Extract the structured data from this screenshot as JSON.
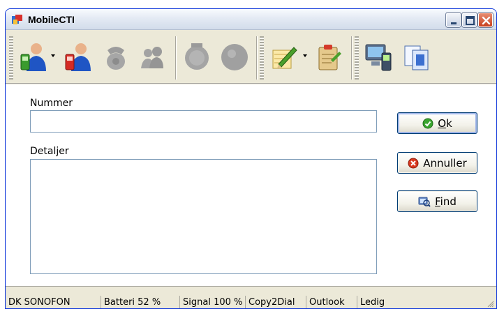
{
  "window": {
    "title": "MobileCTI",
    "controls": [
      "minimize",
      "maximize",
      "close"
    ]
  },
  "toolbar": {
    "buttons": [
      {
        "name": "contacts-call",
        "icon": "person-phone-icon",
        "enabled": true,
        "dropdown": true
      },
      {
        "name": "contacts-mobile",
        "icon": "person-mobile-icon",
        "enabled": true,
        "dropdown": false
      },
      {
        "name": "handset",
        "icon": "handset-icon",
        "enabled": false,
        "dropdown": false
      },
      {
        "name": "people",
        "icon": "people-icon",
        "enabled": false,
        "dropdown": false
      },
      {
        "name": "record",
        "icon": "record-icon",
        "enabled": false,
        "dropdown": false
      },
      {
        "name": "circle",
        "icon": "circle-icon",
        "enabled": false,
        "dropdown": false
      },
      {
        "name": "edit-note",
        "icon": "pencil-note-icon",
        "enabled": true,
        "dropdown": true
      },
      {
        "name": "clipboard",
        "icon": "clipboard-icon",
        "enabled": true,
        "dropdown": false
      },
      {
        "name": "computer-phone",
        "icon": "computer-phone-icon",
        "enabled": true,
        "dropdown": false
      },
      {
        "name": "copy",
        "icon": "copy-icon",
        "enabled": true,
        "dropdown": false
      }
    ]
  },
  "form": {
    "number_label": "Nummer",
    "number_value": "",
    "details_label": "Detaljer",
    "details_value": ""
  },
  "buttons": {
    "ok_label": "Ok",
    "ok_mnemonic": "O",
    "ok_rest": "k",
    "cancel_label": "Annuller",
    "find_label": "Find",
    "find_mnemonic": "F",
    "find_rest": "ind"
  },
  "statusbar": {
    "operator": "DK SONOFON",
    "battery": "Batteri 52 %",
    "signal": "Signal 100 %",
    "copy2dial": "Copy2Dial",
    "outlook": "Outlook",
    "state": "Ledig"
  },
  "colors": {
    "window_face": "#ece9d8",
    "title_border": "#0831d9",
    "close_red": "#c8401e",
    "ok_green": "#3aa52f",
    "cancel_red": "#d9381e"
  }
}
